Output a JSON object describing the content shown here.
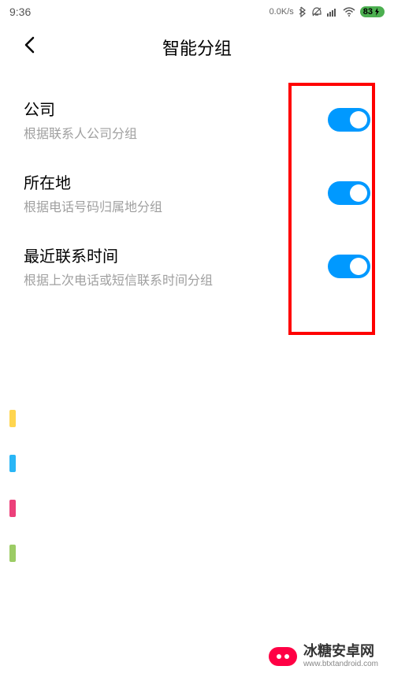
{
  "status_bar": {
    "time": "9:36",
    "net_speed": "0.0K/s",
    "battery_pct": "83"
  },
  "header": {
    "title": "智能分组"
  },
  "settings": [
    {
      "title": "公司",
      "desc": "根据联系人公司分组",
      "enabled": true
    },
    {
      "title": "所在地",
      "desc": "根据电话号码归属地分组",
      "enabled": true
    },
    {
      "title": "最近联系时间",
      "desc": "根据上次电话或短信联系时间分组",
      "enabled": true
    }
  ],
  "watermark": {
    "cn": "冰糖安卓网",
    "en": "www.btxtandroid.com"
  },
  "highlight": {
    "color": "#ff0000"
  },
  "toggle_color": "#0099ff"
}
